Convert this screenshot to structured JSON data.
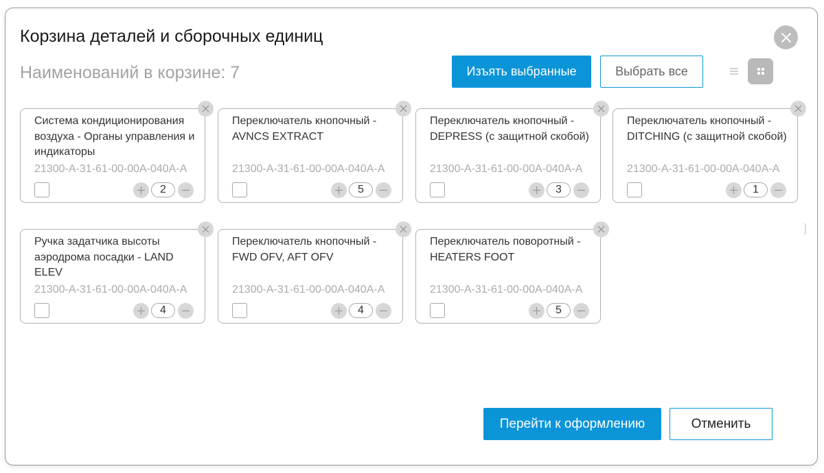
{
  "dialog": {
    "title": "Корзина деталей и сборочных единиц",
    "count_label": "Наименований в корзине: 7"
  },
  "toolbar": {
    "remove_selected_label": "Изъять выбранные",
    "select_all_label": "Выбрать все",
    "view_list_icon": "list-view-icon",
    "view_grid_icon": "grid-view-icon"
  },
  "items": [
    {
      "name": "Система кондиционирования воздуха - Органы управления и индикаторы",
      "code": "21300-A-31-61-00-00A-040A-A",
      "quantity": "2",
      "checked": false
    },
    {
      "name": "Переключатель кнопочный - AVNCS EXTRACT",
      "code": "21300-A-31-61-00-00A-040A-A",
      "quantity": "5",
      "checked": false
    },
    {
      "name": "Переключатель кнопочный - DEPRESS (с защитной скобой)",
      "code": "21300-A-31-61-00-00A-040A-A",
      "quantity": "3",
      "checked": false
    },
    {
      "name": "Переключатель кнопочный - DITCHING (с защитной скобой)",
      "code": "21300-A-31-61-00-00A-040A-A",
      "quantity": "1",
      "checked": false
    },
    {
      "name": "Ручка задатчика высоты аэродрома посадки - LAND ELEV",
      "code": "21300-A-31-61-00-00A-040A-A",
      "quantity": "4",
      "checked": false
    },
    {
      "name": "Переключатель кнопочный - FWD OFV, AFT OFV",
      "code": "21300-A-31-61-00-00A-040A-A",
      "quantity": "4",
      "checked": false
    },
    {
      "name": "Переключатель поворотный - HEATERS FOOT",
      "code": "21300-A-31-61-00-00A-040A-A",
      "quantity": "5",
      "checked": false
    }
  ],
  "footer": {
    "checkout_label": "Перейти к оформлению",
    "cancel_label": "Отменить"
  },
  "colors": {
    "accent": "#0b95d8",
    "muted_text": "#a3a3a3",
    "border": "#b0b0b0"
  }
}
